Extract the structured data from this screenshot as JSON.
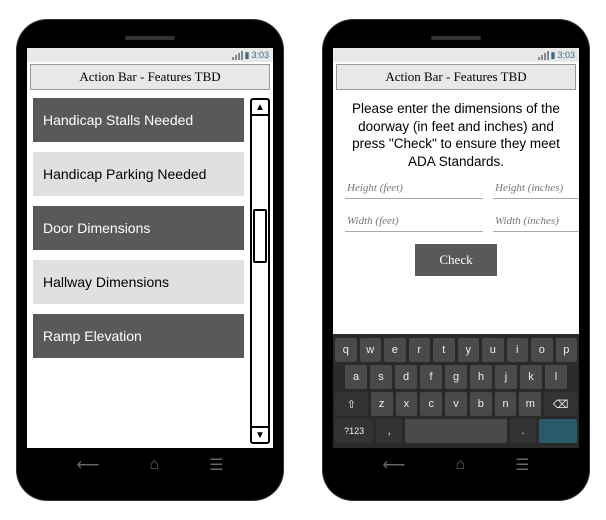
{
  "status": {
    "time": "3:03"
  },
  "action_bar": {
    "title": "Action Bar - Features TBD"
  },
  "left": {
    "items": [
      {
        "label": "Handicap Stalls Needed",
        "style": "dark"
      },
      {
        "label": "Handicap Parking Needed",
        "style": "light"
      },
      {
        "label": "Door Dimensions",
        "style": "dark"
      },
      {
        "label": "Hallway Dimensions",
        "style": "light"
      },
      {
        "label": "Ramp Elevation",
        "style": "dark"
      }
    ]
  },
  "right": {
    "instruction": "Please enter the dimensions of the doorway (in feet and inches) and press \"Check\" to ensure they meet ADA Standards.",
    "fields": {
      "height_feet": "Height (feet)",
      "height_inches": "Height (inches)",
      "width_feet": "Width (feet)",
      "width_inches": "Width (inches)"
    },
    "check_label": "Check",
    "keyboard": {
      "row1": [
        "q",
        "w",
        "e",
        "r",
        "t",
        "y",
        "u",
        "i",
        "o",
        "p"
      ],
      "row2": [
        "a",
        "s",
        "d",
        "f",
        "g",
        "h",
        "j",
        "k",
        "l"
      ],
      "row3_shift": "⇧",
      "row3": [
        "z",
        "x",
        "c",
        "v",
        "b",
        "n",
        "m"
      ],
      "row3_bksp": "⌫",
      "row4_sym": "?123",
      "row4_comma": ",",
      "row4_space": "",
      "row4_period": ".",
      "row4_enter": ""
    }
  }
}
